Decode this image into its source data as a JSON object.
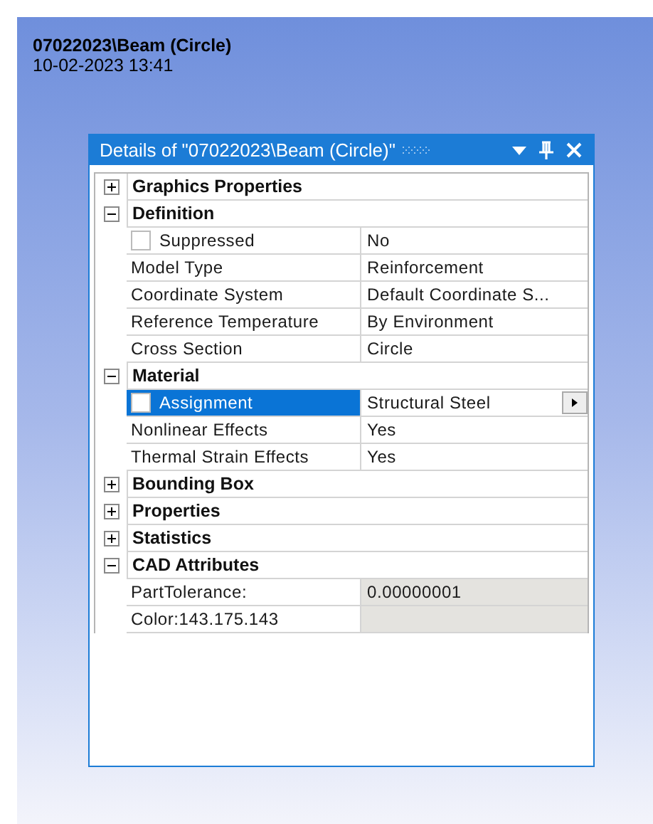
{
  "header": {
    "title": "07022023\\Beam (Circle)",
    "timestamp": "10-02-2023 13:41"
  },
  "panel": {
    "title": "Details of \"07022023\\Beam (Circle)\"",
    "groups": [
      {
        "name": "Graphics Properties",
        "expanded": false
      },
      {
        "name": "Definition",
        "expanded": true,
        "rows": [
          {
            "kind": "checkbox",
            "label": "Suppressed",
            "value": "No",
            "checked": false,
            "selected": false
          },
          {
            "kind": "plain",
            "label": "Model Type",
            "value": "Reinforcement",
            "selected": false
          },
          {
            "kind": "plain",
            "label": "Coordinate System",
            "value": "Default Coordinate S...",
            "selected": false
          },
          {
            "kind": "plain",
            "label": "Reference Temperature",
            "value": "By Environment",
            "selected": false
          },
          {
            "kind": "plain",
            "label": "Cross Section",
            "value": "Circle",
            "selected": false
          }
        ]
      },
      {
        "name": "Material",
        "expanded": true,
        "rows": [
          {
            "kind": "dropdown",
            "label": "Assignment",
            "value": "Structural Steel",
            "checked": false,
            "selected": true
          },
          {
            "kind": "plain",
            "label": "Nonlinear Effects",
            "value": "Yes",
            "selected": false
          },
          {
            "kind": "plain",
            "label": "Thermal Strain Effects",
            "value": "Yes",
            "selected": false
          }
        ]
      },
      {
        "name": "Bounding Box",
        "expanded": false
      },
      {
        "name": "Properties",
        "expanded": false
      },
      {
        "name": "Statistics",
        "expanded": false
      },
      {
        "name": "CAD Attributes",
        "expanded": true,
        "rows": [
          {
            "kind": "readonly",
            "label": "PartTolerance:",
            "value": "0.00000001",
            "selected": false
          },
          {
            "kind": "readonly",
            "label": "Color:143.175.143",
            "selected": false
          }
        ]
      }
    ]
  }
}
